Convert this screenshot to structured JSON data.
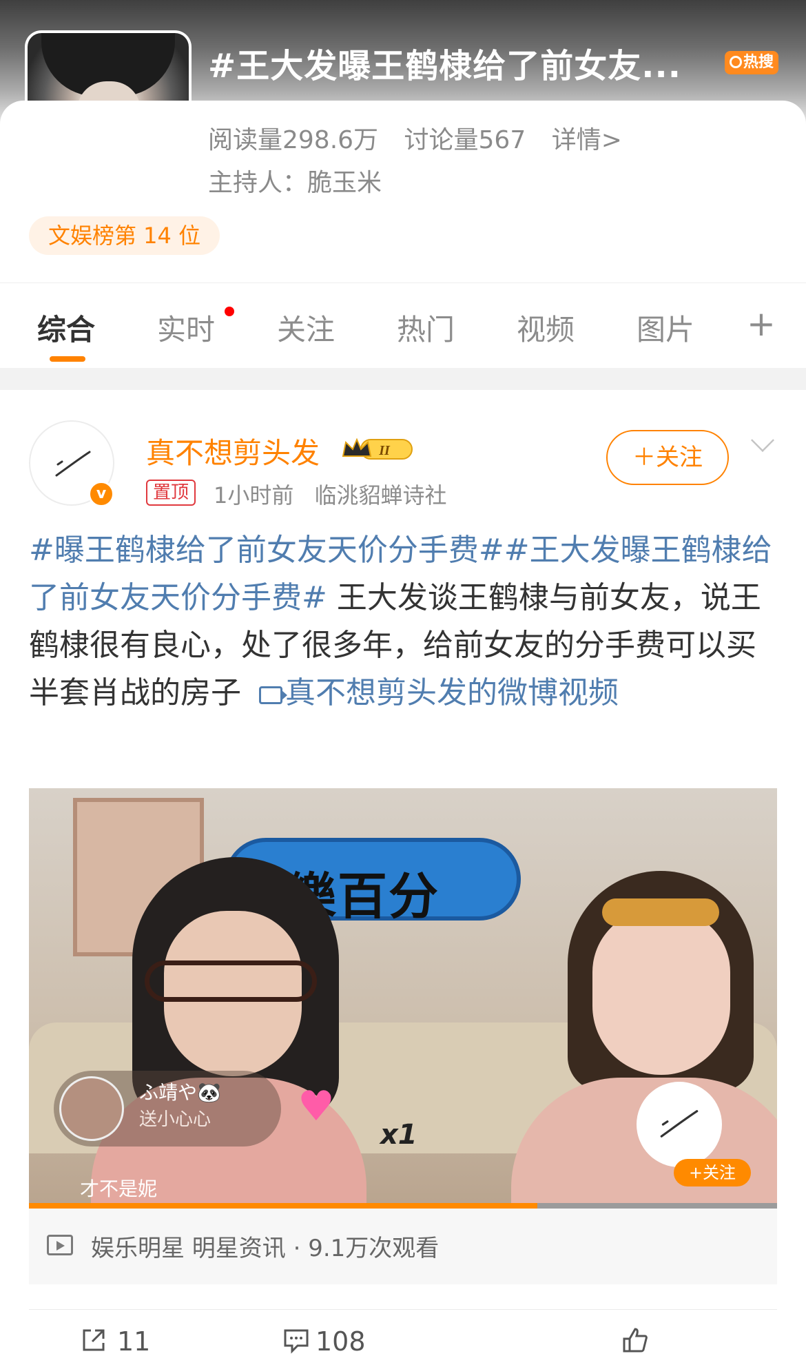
{
  "header": {
    "topic_title": "#王大发曝王鹤棣给了前女友...",
    "hot_badge": "热搜",
    "read_count": "阅读量298.6万",
    "discuss_count": "讨论量567",
    "details_link": "详情>",
    "host": "主持人：脆玉米",
    "rank_badge": "文娱榜第 14 位"
  },
  "tabs": [
    {
      "label": "综合",
      "active": true
    },
    {
      "label": "实时",
      "has_red_dot": true
    },
    {
      "label": "关注"
    },
    {
      "label": "热门"
    },
    {
      "label": "视频"
    },
    {
      "label": "图片"
    }
  ],
  "tabs_more": "+",
  "post": {
    "username": "真不想剪头发",
    "vip_level": "II",
    "pinned_label": "置顶",
    "time": "1小时前",
    "source": "临洮貂蝉诗社",
    "follow_label": "＋关注",
    "tag1": "#曝王鹤棣给了前女友天价分手费#",
    "tag2": "#王大发曝王鹤棣给了前女友天价分手费#",
    "body": " 王大发谈王鹤棣与前女友，说王鹤棣很有良心，处了很多年，给前女友的分手费可以买半套肖战的房子 ",
    "video_link": "真不想剪头发的微博视频",
    "video": {
      "sign_text": "娛樂百分",
      "gift_user": "ふ靖や🐼",
      "gift_text": "送小心心",
      "gift_count": "x1",
      "caption": "才不是妮",
      "float_follow": "+关注",
      "progress": 0.68,
      "info": "娱乐明星 明星资讯 · 9.1万次观看"
    },
    "actions": {
      "share_count": "11",
      "comment_count": "108"
    }
  },
  "colors": {
    "accent": "#ff8200",
    "link": "#507daf",
    "pinned": "#e0393e"
  }
}
